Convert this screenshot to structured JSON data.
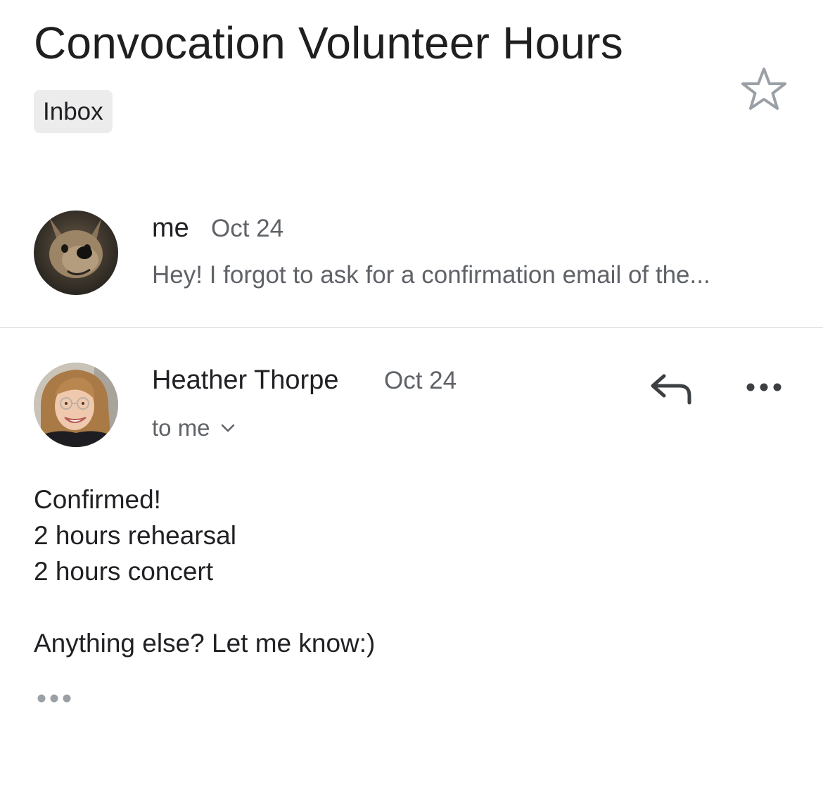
{
  "thread": {
    "subject": "Convocation Volunteer Hours",
    "label": "Inbox",
    "star_icon": "star-outline-icon"
  },
  "messages": [
    {
      "sender": "me",
      "date": "Oct 24",
      "snippet": "Hey! I forgot to ask for a confirmation email of the...",
      "avatar": "dog-photo-avatar"
    },
    {
      "sender": "Heather Thorpe",
      "date": "Oct 24",
      "recipient_line": "to me",
      "avatar": "woman-photo-avatar",
      "body_lines": [
        "Confirmed!",
        "2 hours rehearsal",
        "2 hours concert",
        "",
        "Anything else?  Let me know:)"
      ],
      "actions": {
        "reply_icon": "reply-icon",
        "more_icon": "more-horizontal-icon",
        "show_trimmed_icon": "ellipsis-icon"
      }
    }
  ],
  "colors": {
    "primary_text": "#202124",
    "secondary_text": "#5f6368",
    "chip_background": "#ececec",
    "divider": "#dadce0",
    "icon_gray": "#9aa0a6"
  }
}
